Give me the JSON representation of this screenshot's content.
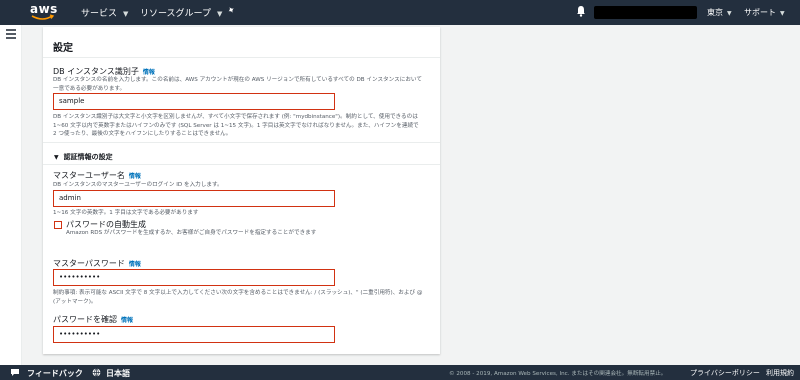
{
  "topnav": {
    "logo_text": "aws",
    "services_label": "サービス",
    "resource_groups_label": "リソースグループ",
    "pin_icon": "pushpin-icon",
    "bell_icon": "bell-icon",
    "region_label": "東京",
    "support_label": "サポート"
  },
  "rail": {
    "menu_icon": "hamburger-icon"
  },
  "panel": {
    "title": "設定",
    "db_identifier": {
      "label": "DB インスタンス識別子",
      "info": "情報",
      "description": "DB インスタンスの名前を入力します。この名前は、AWS アカウントが現在の AWS リージョンで所有しているすべての DB インスタンスにおいて一意である必要があります。",
      "value": "sample",
      "constraints": "DB インスタンス識別子は大文字と小文字を区別しませんが、すべて小文字で保存されます (例: \"mydbinstance\")。制約として、使用できるのは 1~60 文字以内で英数字またはハイフンのみです (SQL Server は 1~15 文字)。1 字目は英文字でなければなりません。また、ハイフンを連続で 2 つ使ったり、最後の文字をハイフンにしたりすることはできません。"
    },
    "credentials_section": {
      "title": "認証情報の設定",
      "master_username": {
        "label": "マスターユーザー名",
        "info": "情報",
        "description": "DB インスタンスのマスターユーザーのログイン ID を入力します。",
        "value": "admin",
        "constraints": "1~16 文字の英数字。1 字目は文字である必要があります"
      },
      "auto_password": {
        "label": "パスワードの自動生成",
        "description": "Amazon RDS がパスワードを生成するか、お客様がご自身でパスワードを指定することができます",
        "checked": false
      },
      "master_password": {
        "label": "マスターパスワード",
        "info": "情報",
        "value": "••••••••••",
        "constraints": "制約事項: 表示可能な ASCII 文字で 8 文字以上で入力してください次の文字を含めることはできません: / (スラッシュ)、\" (二重引用符)、および @ (アットマーク)。"
      },
      "confirm_password": {
        "label": "パスワードを確認",
        "info": "情報",
        "value": "••••••••••"
      }
    }
  },
  "footer": {
    "feedback_label": "フィードバック",
    "feedback_icon": "speech-bubble-icon",
    "language_label": "日本語",
    "globe_icon": "globe-icon",
    "copyright": "© 2008 - 2019, Amazon Web Services, Inc. またはその関連会社。無断転用禁止。",
    "privacy_label": "プライバシーポリシー",
    "terms_label": "利用規約"
  },
  "colors": {
    "nav_bg": "#232f3e",
    "error_border": "#d13212",
    "link": "#0073bb",
    "page_bg": "#f2f3f3"
  }
}
